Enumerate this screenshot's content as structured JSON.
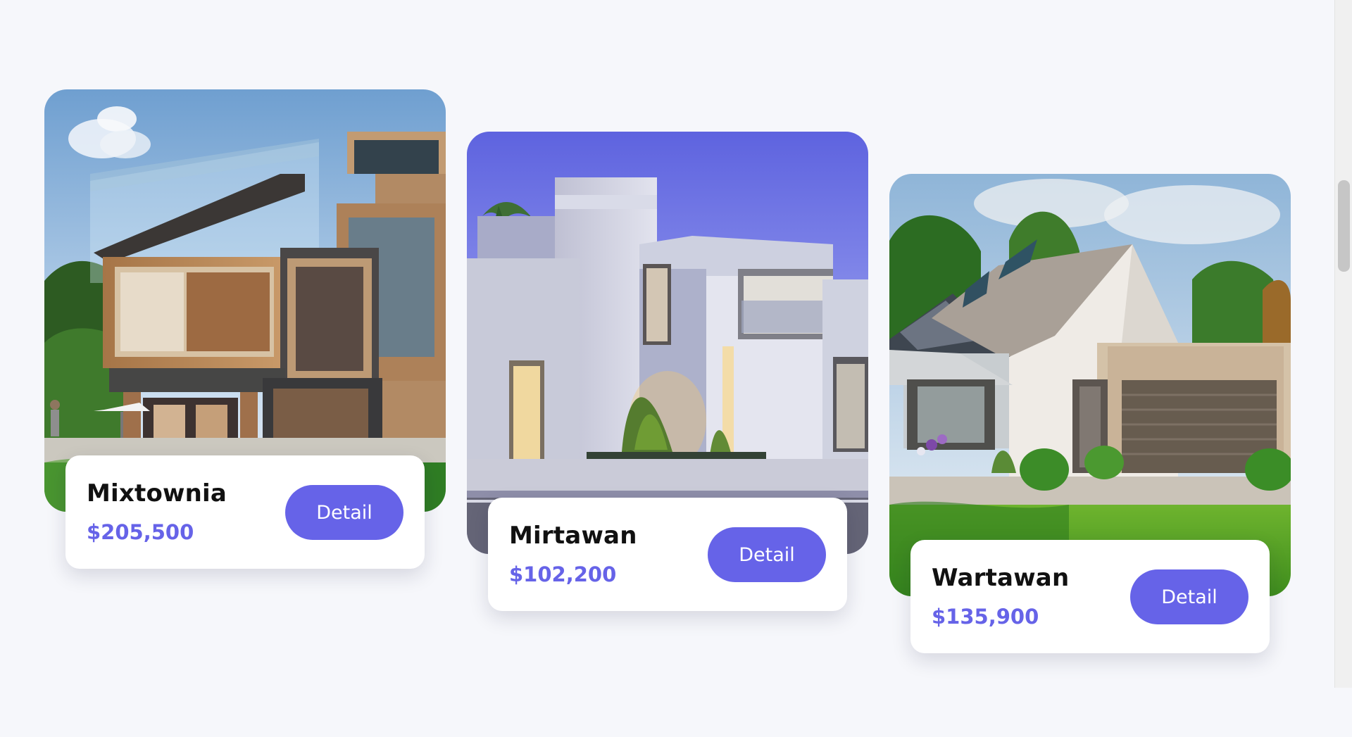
{
  "listings": [
    {
      "name": "Mixtownia",
      "price": "$205,500",
      "detail_label": "Detail",
      "image": "modern-house-glass-balcony",
      "colors": {
        "sky": "#8eb6dc",
        "wood": "#b9875b",
        "dark": "#3a3a3c",
        "grass": "#2f7d24"
      }
    },
    {
      "name": "Mirtawan",
      "price": "$102,200",
      "detail_label": "Detail",
      "image": "white-cube-villa-twilight",
      "colors": {
        "sky": "#6b6fe2",
        "wall": "#d7d8e8",
        "shadow": "#9fa2c3",
        "glow": "#f4d08a"
      }
    },
    {
      "name": "Wartawan",
      "price": "$135,900",
      "detail_label": "Detail",
      "image": "gable-house-garage",
      "colors": {
        "sky": "#b9d7ee",
        "roof": "#a69d94",
        "wall": "#f2efeb",
        "grass": "#58a329"
      }
    }
  ],
  "theme": {
    "background": "#f6f7fb",
    "accent": "#6663e8",
    "card": "#ffffff"
  }
}
